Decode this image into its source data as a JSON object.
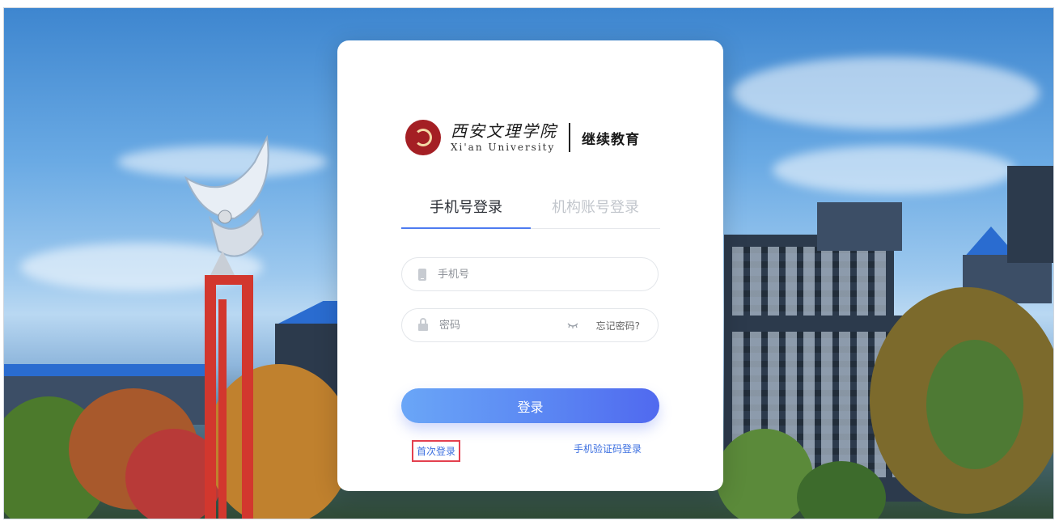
{
  "logo": {
    "name_cn": "西安文理学院",
    "name_en": "Xi'an University",
    "section": "继续教育"
  },
  "tabs": [
    {
      "label": "手机号登录",
      "active": true
    },
    {
      "label": "机构账号登录",
      "active": false
    }
  ],
  "form": {
    "phone_placeholder": "手机号",
    "password_placeholder": "密码",
    "forgot_label": "忘记密码?"
  },
  "login_button": "登录",
  "links": {
    "first_login": "首次登录",
    "sms_login": "手机验证码登录"
  },
  "colors": {
    "accent": "#4e7bf0",
    "highlight_box": "#e4404f"
  }
}
